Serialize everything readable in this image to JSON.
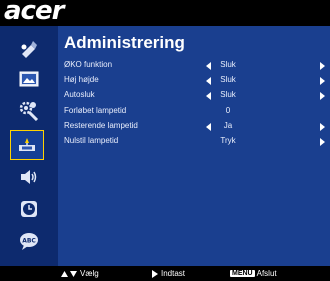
{
  "brand": "acer",
  "title": "Administrering",
  "sidebar": {
    "items": [
      {
        "icon": "color-settings-icon"
      },
      {
        "icon": "picture-icon"
      },
      {
        "icon": "advanced-settings-icon"
      },
      {
        "icon": "management-icon",
        "selected": true
      },
      {
        "icon": "audio-icon"
      },
      {
        "icon": "timer-icon"
      },
      {
        "icon": "language-icon",
        "text": "ABC"
      }
    ]
  },
  "menu": {
    "rows": [
      {
        "label": "ØKO funktion",
        "value": "Sluk",
        "left_arrow": true,
        "right_arrow": true
      },
      {
        "label": "Høj højde",
        "value": "Sluk",
        "left_arrow": true,
        "right_arrow": true
      },
      {
        "label": "Autosluk",
        "value": "Sluk",
        "left_arrow": true,
        "right_arrow": true
      },
      {
        "label": "Forløbet lampetid",
        "value": "0",
        "left_arrow": false,
        "right_arrow": false
      },
      {
        "label": "Resterende lampetid",
        "value": "Ja",
        "left_arrow": true,
        "right_arrow": true
      },
      {
        "label": "Nulstil lampetid",
        "value": "Tryk",
        "left_arrow": false,
        "right_arrow": true
      }
    ]
  },
  "footer": {
    "select_label": "Vælg",
    "enter_label": "Indtast",
    "menu_key": "MENU",
    "exit_label": "Afslut"
  },
  "colors": {
    "background": "#1a3f8f",
    "sidebar": "#0d2a6e",
    "selection_border": "#ffd200",
    "text": "#e9eefc"
  }
}
